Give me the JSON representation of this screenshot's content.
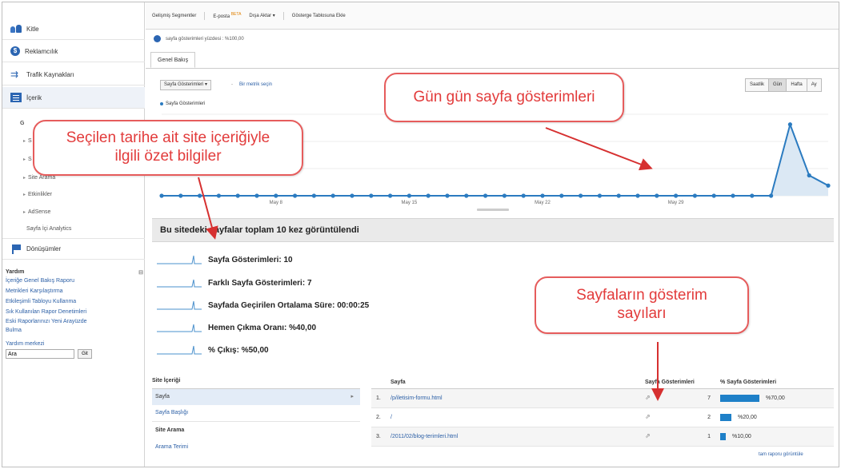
{
  "sidebar": {
    "items": [
      {
        "label": "Kitle",
        "icon": "audience-icon"
      },
      {
        "label": "Reklamcılık",
        "icon": "advertising-icon"
      },
      {
        "label": "Trafik Kaynakları",
        "icon": "traffic-sources-icon"
      },
      {
        "label": "İçerik",
        "icon": "content-icon"
      }
    ],
    "sub_items": [
      "G",
      "S",
      "S",
      "Site Arama",
      "Etkinlikler",
      "AdSense",
      "Sayfa İçi Analytics"
    ],
    "conversions_label": "Dönüşümler",
    "help": {
      "title": "Yardım",
      "links": [
        "İçeriğe Genel Bakış Raporu",
        "Metrikleri Karşılaştırma",
        "Etkileşimli Tabloyu Kullanma",
        "Sık Kullanılan Rapor Denetimleri",
        "Eski Raporlarınızı Yeni Arayüzde",
        "Bulma"
      ],
      "center_title": "Yardım merkezi",
      "search_placeholder": "Ara",
      "search_button": "Git"
    }
  },
  "toolbar": {
    "advanced_segments": "Gelişmiş Segmentler",
    "email": "E-posta",
    "beta": "BETA",
    "export": "Dışa Aktar ▾",
    "add_dashboard": "Gösterge Tablosuna Ekle"
  },
  "segment": {
    "label": "sayfa gösterimleri yüzdesi : %100,00"
  },
  "tab": {
    "label": "Genel Bakış"
  },
  "metric_selector": {
    "selected": "Sayfa Gösterimleri ▾",
    "vs": "-",
    "pick": "Bir metrik seçin"
  },
  "period_buttons": [
    {
      "label": "Saatlik",
      "active": false
    },
    {
      "label": "Gün",
      "active": true
    },
    {
      "label": "Hafta",
      "active": false
    },
    {
      "label": "Ay",
      "active": false
    }
  ],
  "legend": {
    "label": "Sayfa Gösterimleri"
  },
  "chart_data": {
    "type": "area",
    "series": [
      {
        "name": "Sayfa Gösterimleri",
        "values": [
          0,
          0,
          0,
          0,
          0,
          0,
          0,
          0,
          0,
          0,
          0,
          0,
          0,
          0,
          0,
          0,
          0,
          0,
          0,
          0,
          0,
          0,
          0,
          0,
          0,
          0,
          0,
          0,
          0,
          0,
          0,
          0,
          0,
          7,
          2,
          1
        ]
      }
    ],
    "x_tick_labels": [
      "May 8",
      "May 15",
      "May 22",
      "May 29"
    ],
    "x_tick_indices": [
      6,
      13,
      20,
      27
    ],
    "ylim": [
      0,
      8
    ],
    "color": "#2b7bc0",
    "fill": "#dbe8f4",
    "grid": true
  },
  "summary": {
    "headline": "Bu sitedeki sayfalar toplam 10 kez görüntülendi"
  },
  "stats": [
    {
      "label": "Sayfa Gösterimleri:",
      "value": "10"
    },
    {
      "label": "Farklı Sayfa Gösterimleri:",
      "value": "7"
    },
    {
      "label": "Sayfada Geçirilen Ortalama Süre:",
      "value": "00:00:25"
    },
    {
      "label": "Hemen Çıkma Oranı:",
      "value": "%40,00"
    },
    {
      "label": "% Çıkış:",
      "value": "%50,00"
    }
  ],
  "dimensions": {
    "section1_title": "Site İçeriği",
    "selected": "Sayfa",
    "selected_arrow": "▸",
    "link1": "Sayfa Başlığı",
    "section2_title": "Site Arama",
    "link2": "Arama Terimi"
  },
  "table": {
    "headers": {
      "page": "Sayfa",
      "views": "Sayfa Gösterimleri",
      "pct": "% Sayfa Gösterimleri"
    },
    "rows": [
      {
        "num": "1.",
        "url": "/p/iletisim-formu.html",
        "views": "7",
        "pct": "%70,00",
        "share": 0.7
      },
      {
        "num": "2.",
        "url": "/",
        "views": "2",
        "pct": "%20,00",
        "share": 0.2
      },
      {
        "num": "3.",
        "url": "/2011/02/blog-terimleri.html",
        "views": "1",
        "pct": "%10,00",
        "share": 0.1
      }
    ],
    "full_report": "tam raporu görüntüle"
  },
  "annotations": {
    "daily_views": "Gün gün sayfa gösterimleri",
    "summary_line1": "Seçilen tarihe ait site içeriğiyle",
    "summary_line2": "ilgili özet bilgiler",
    "page_counts_line1": "Sayfaların gösterim",
    "page_counts_line2": "sayıları"
  }
}
